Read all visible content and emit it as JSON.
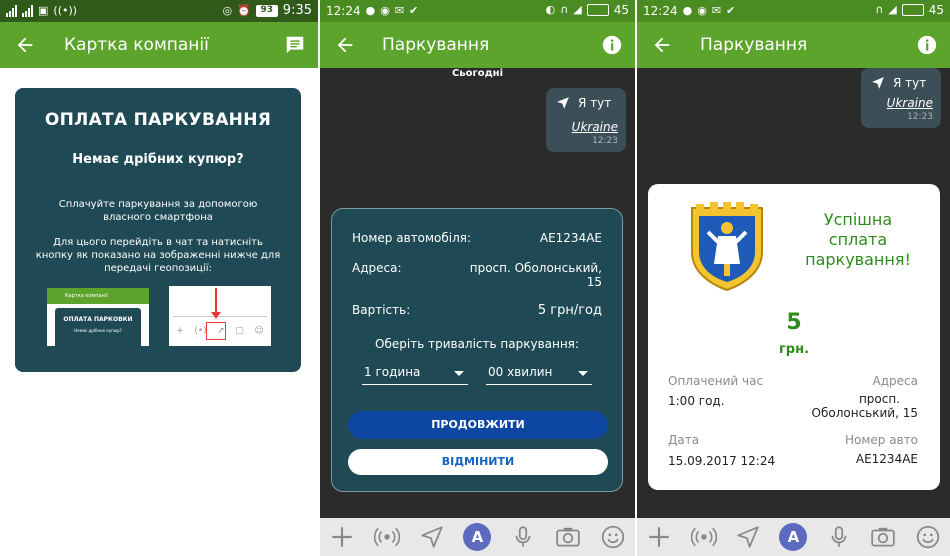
{
  "colors": {
    "green_bar": "#5da42d",
    "dark_status": "#2f5a1a",
    "card_teal": "#1f4a55",
    "success_green": "#2e8b1e",
    "primary_blue": "#0d47a1"
  },
  "screen1": {
    "status": {
      "battery": "93",
      "time": "9:35"
    },
    "title": "Картка компанії",
    "card": {
      "title": "ОПЛАТА ПАРКУВАННЯ",
      "subtitle": "Немає дрібних купюр?",
      "para1": "Сплачуйте паркування за допомогою власного смартфона",
      "para2": "Для цього перейдіть в чат та натисніть кнопку як показано на зображенні нижче для передачі геопозиції:",
      "thumb_title": "Картка компанії",
      "thumb_card_title": "ОПЛАТА ПАРКОВКИ",
      "thumb_card_sub": "Немає дрібних купюр?"
    }
  },
  "screen2": {
    "status": {
      "time": "12:24",
      "battery": "45"
    },
    "title": "Паркування",
    "date_sep": "Сьогодні",
    "location": {
      "label": "Я тут",
      "place": "Ukraine",
      "time": "12:23"
    },
    "form": {
      "car_label": "Номер автомобіля:",
      "car_value": "AE1234AE",
      "address_label": "Адреса:",
      "address_value_line1": "просп. Оболонський,",
      "address_value_line2": "15",
      "price_label": "Вартість:",
      "price_value": "5 грн/год",
      "duration_label": "Оберіть тривалість паркування:",
      "hours_selected": "1 година",
      "minutes_selected": "00 хвилин",
      "continue_label": "ПРОДОВЖИТИ",
      "cancel_label": "ВІДМІНИТИ"
    }
  },
  "screen3": {
    "status": {
      "time": "12:24",
      "battery": "45"
    },
    "title": "Паркування",
    "location": {
      "label": "Я тут",
      "place": "Ukraine",
      "time": "12:23"
    },
    "success": {
      "title_line1": "Успішна",
      "title_line2": "сплата",
      "title_line3": "паркування!",
      "amount": "5",
      "unit": "грн.",
      "paid_time_label": "Оплачений час",
      "paid_time_value": "1:00 год.",
      "address_label": "Адреса",
      "address_value_line1": "просп.",
      "address_value_line2": "Оболонський, 15",
      "date_label": "Дата",
      "date_value": "15.09.2017 12:24",
      "car_label": "Номер авто",
      "car_value": "AE1234AE"
    }
  },
  "input_bar_icons": [
    "plus-icon",
    "broadcast-icon",
    "location-arrow-icon",
    "a-badge",
    "microphone-icon",
    "camera-icon",
    "smiley-icon"
  ]
}
